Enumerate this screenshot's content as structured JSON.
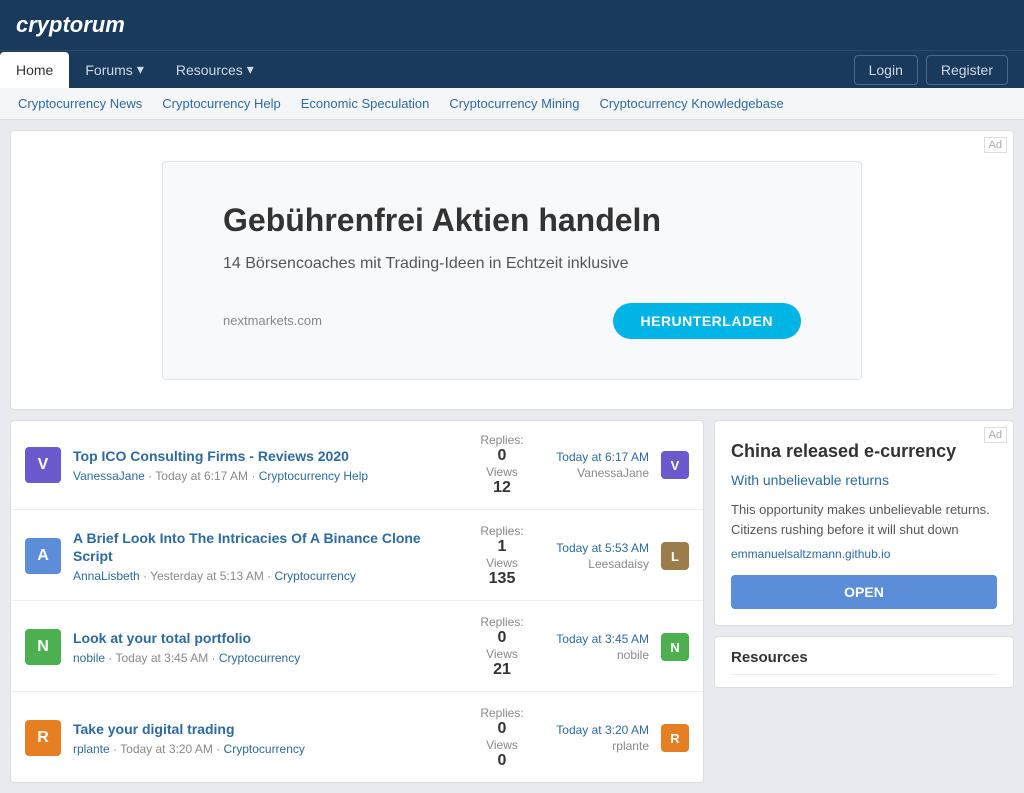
{
  "site": {
    "logo": "cryptorum",
    "nav": {
      "items": [
        {
          "label": "Home",
          "active": true
        },
        {
          "label": "Forums",
          "dropdown": true
        },
        {
          "label": "Resources",
          "dropdown": true
        }
      ],
      "auth": [
        {
          "label": "Login"
        },
        {
          "label": "Register"
        }
      ]
    },
    "subnav": [
      {
        "label": "Cryptocurrency News"
      },
      {
        "label": "Cryptocurrency Help"
      },
      {
        "label": "Economic Speculation"
      },
      {
        "label": "Cryptocurrency Mining"
      },
      {
        "label": "Cryptocurrency Knowledgebase"
      }
    ]
  },
  "ad_banner": {
    "label": "Ad",
    "title": "Gebührenfrei Aktien handeln",
    "subtitle": "14 Börsencoaches mit Trading-Ideen in Echtzeit inklusive",
    "domain": "nextmarkets.com",
    "button": "HERUNTERLADEN"
  },
  "threads": [
    {
      "id": 1,
      "avatar_letter": "V",
      "avatar_class": "avatar-v",
      "title": "Top ICO Consulting Firms - Reviews 2020",
      "author": "VanessaJane",
      "posted": "Today at 6:17 AM",
      "category": "Cryptocurrency Help",
      "replies": 0,
      "views": 12,
      "latest_time": "Today at 6:17 AM",
      "latest_user": "VanessaJane",
      "latest_avatar_letter": "V",
      "latest_avatar_class": "avatar-v"
    },
    {
      "id": 2,
      "avatar_letter": "A",
      "avatar_class": "avatar-a",
      "title": "A Brief Look Into The Intricacies Of A Binance Clone Script",
      "author": "AnnaLisbeth",
      "posted": "Yesterday at 5:13 AM",
      "category": "Cryptocurrency",
      "replies": 1,
      "views": 135,
      "latest_time": "Today at 5:53 AM",
      "latest_user": "Leesadaisy",
      "latest_avatar_letter": "L",
      "latest_avatar_class": "avatar-l"
    },
    {
      "id": 3,
      "avatar_letter": "N",
      "avatar_class": "avatar-n",
      "title": "Look at your total portfolio",
      "author": "nobile",
      "posted": "Today at 3:45 AM",
      "category": "Cryptocurrency",
      "replies": 0,
      "views": 21,
      "latest_time": "Today at 3:45 AM",
      "latest_user": "nobile",
      "latest_avatar_letter": "N",
      "latest_avatar_class": "avatar-n"
    },
    {
      "id": 4,
      "avatar_letter": "R",
      "avatar_class": "avatar-r",
      "title": "Take your digital trading",
      "author": "rplante",
      "posted": "Today at 3:20 AM",
      "category": "Cryptocurrency",
      "replies": 0,
      "views": 0,
      "latest_time": "Today at 3:20 AM",
      "latest_user": "rplante",
      "latest_avatar_letter": "R",
      "latest_avatar_class": "avatar-r"
    }
  ],
  "sidebar_ad": {
    "label": "Ad",
    "title": "China released e-currency",
    "subtitle": "With unbelievable returns",
    "text": "This opportunity makes unbelievable returns. Citizens rushing before it will shut down",
    "domain": "emmanuelsaltzmann.github.io",
    "button": "OPEN"
  },
  "sidebar_resources": {
    "title": "Resources"
  }
}
